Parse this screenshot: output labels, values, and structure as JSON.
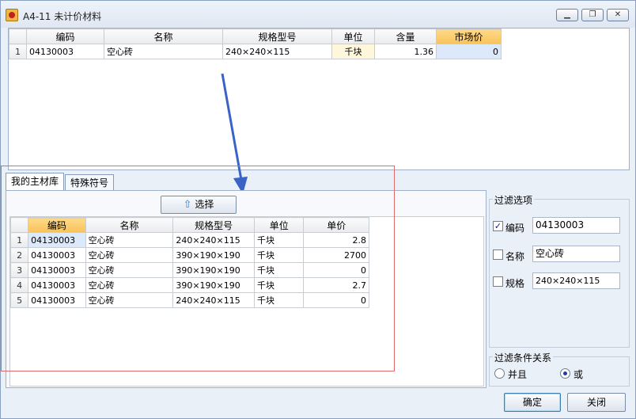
{
  "window": {
    "title": "A4-11  未计价材料",
    "minimize_label": "▁",
    "restore_label": "❐",
    "close_label": "✕"
  },
  "top_table": {
    "headers": [
      "",
      "编码",
      "名称",
      "规格型号",
      "单位",
      "含量",
      "市场价"
    ],
    "rows": [
      [
        "1",
        "04130003",
        "空心砖",
        "240×240×115",
        "千块",
        "1.36",
        "0"
      ]
    ]
  },
  "tabs": [
    {
      "label": "我的主材库"
    },
    {
      "label": "特殊符号"
    }
  ],
  "select_button": {
    "label": "选择"
  },
  "library_table": {
    "headers": [
      "",
      "编码",
      "名称",
      "规格型号",
      "单位",
      "单价"
    ],
    "rows": [
      [
        "1",
        "04130003",
        "空心砖",
        "240×240×115",
        "千块",
        "2.8"
      ],
      [
        "2",
        "04130003",
        "空心砖",
        "390×190×190",
        "千块",
        "2700"
      ],
      [
        "3",
        "04130003",
        "空心砖",
        "390×190×190",
        "千块",
        "0"
      ],
      [
        "4",
        "04130003",
        "空心砖",
        "390×190×190",
        "千块",
        "2.7"
      ],
      [
        "5",
        "04130003",
        "空心砖",
        "240×240×115",
        "千块",
        "0"
      ]
    ]
  },
  "filter": {
    "title": "过滤选项",
    "code": {
      "label": "编码",
      "checked": true,
      "value": "04130003"
    },
    "name": {
      "label": "名称",
      "checked": false,
      "value": "空心砖"
    },
    "spec": {
      "label": "规格",
      "checked": false,
      "value": "240×240×115"
    }
  },
  "relation": {
    "title": "过滤条件关系",
    "and_label": "并且",
    "or_label": "或",
    "selected": "or"
  },
  "footer": {
    "ok_label": "确定",
    "close_label": "关闭"
  },
  "colors": {
    "arrow": "#3a63c8",
    "highlight_header": "#f7c35a",
    "selection_outline": "#e06a6a"
  }
}
